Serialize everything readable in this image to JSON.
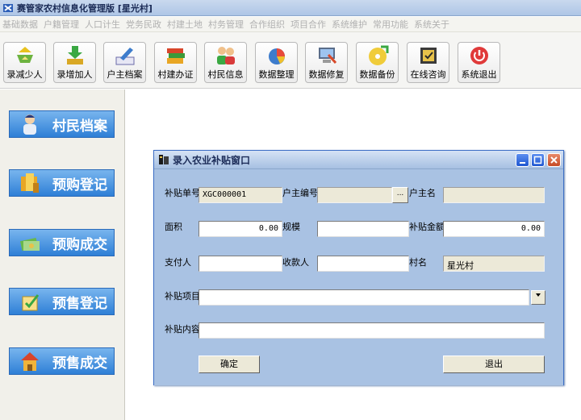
{
  "window": {
    "title": "赛管家农村信息化管理版 [星光村]"
  },
  "menu": [
    "基础数据",
    "户籍管理",
    "人口计生",
    "党务民政",
    "村建土地",
    "村务管理",
    "合作组织",
    "项目合作",
    "系统维护",
    "常用功能",
    "系统关于"
  ],
  "toolbar": [
    {
      "label": "录减少人",
      "icon": "recycle-icon"
    },
    {
      "label": "录增加人",
      "icon": "download-icon"
    },
    {
      "label": "户主档案",
      "icon": "pen-icon"
    },
    {
      "label": "村建办证",
      "icon": "books-icon"
    },
    {
      "label": "村民信息",
      "icon": "people-icon"
    },
    {
      "label": "数据整理",
      "icon": "pie-chart-icon"
    },
    {
      "label": "数据修复",
      "icon": "computer-tool-icon"
    },
    {
      "label": "数据备份",
      "icon": "disc-icon"
    },
    {
      "label": "在线咨询",
      "icon": "certificate-icon"
    },
    {
      "label": "系统退出",
      "icon": "power-icon"
    }
  ],
  "sidebar": [
    {
      "label": "村民档案",
      "icon": "person-icon"
    },
    {
      "label": "预购登记",
      "icon": "folder-icon"
    },
    {
      "label": "预购成交",
      "icon": "money-icon"
    },
    {
      "label": "预售登记",
      "icon": "checklist-icon"
    },
    {
      "label": "预售成交",
      "icon": "house-icon"
    }
  ],
  "dialog": {
    "title": "录入农业补贴窗口",
    "labels": {
      "subsidy_no": "补贴单号",
      "householder_no": "户主编号",
      "householder_name": "户主名",
      "area": "面积",
      "scale": "规模",
      "subsidy_amount": "补贴金额",
      "payer": "支付人",
      "payee": "收款人",
      "village_name": "村名",
      "subsidy_item": "补贴项目",
      "subsidy_content": "补贴内容"
    },
    "values": {
      "subsidy_no": "XGC000001",
      "householder_no": "",
      "householder_name": "",
      "area": "0.00",
      "scale": "",
      "subsidy_amount": "0.00",
      "payer": "",
      "payee": "",
      "village_name": "星光村",
      "subsidy_item": "",
      "subsidy_content": ""
    },
    "browse_label": "...",
    "confirm_label": "确定",
    "exit_label": "退出"
  }
}
